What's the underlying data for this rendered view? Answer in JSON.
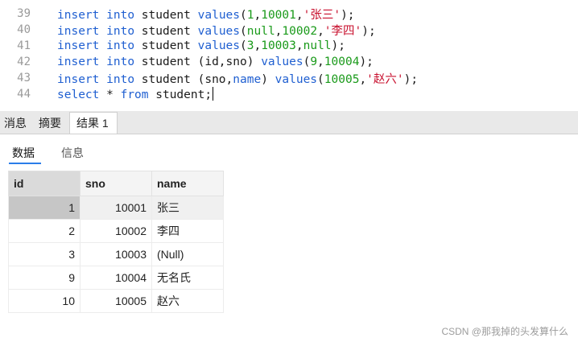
{
  "editor": {
    "lines": [
      {
        "num": "39",
        "code": [
          {
            "t": "insert",
            "c": "kw"
          },
          {
            "t": " "
          },
          {
            "t": "into",
            "c": "kw"
          },
          {
            "t": " student "
          },
          {
            "t": "values",
            "c": "kw"
          },
          {
            "t": "("
          },
          {
            "t": "1",
            "c": "num"
          },
          {
            "t": ","
          },
          {
            "t": "10001",
            "c": "num"
          },
          {
            "t": ","
          },
          {
            "t": "'张三'",
            "c": "str"
          },
          {
            "t": ");"
          }
        ]
      },
      {
        "num": "40",
        "code": [
          {
            "t": "insert",
            "c": "kw"
          },
          {
            "t": " "
          },
          {
            "t": "into",
            "c": "kw"
          },
          {
            "t": " student "
          },
          {
            "t": "values",
            "c": "kw"
          },
          {
            "t": "("
          },
          {
            "t": "null",
            "c": "num"
          },
          {
            "t": ","
          },
          {
            "t": "10002",
            "c": "num"
          },
          {
            "t": ","
          },
          {
            "t": "'李四'",
            "c": "str"
          },
          {
            "t": ");"
          }
        ]
      },
      {
        "num": "41",
        "code": [
          {
            "t": "insert",
            "c": "kw"
          },
          {
            "t": " "
          },
          {
            "t": "into",
            "c": "kw"
          },
          {
            "t": " student "
          },
          {
            "t": "values",
            "c": "kw"
          },
          {
            "t": "("
          },
          {
            "t": "3",
            "c": "num"
          },
          {
            "t": ","
          },
          {
            "t": "10003",
            "c": "num"
          },
          {
            "t": ","
          },
          {
            "t": "null",
            "c": "num"
          },
          {
            "t": ");"
          }
        ]
      },
      {
        "num": "42",
        "code": [
          {
            "t": "insert",
            "c": "kw"
          },
          {
            "t": " "
          },
          {
            "t": "into",
            "c": "kw"
          },
          {
            "t": " student (id,sno) "
          },
          {
            "t": "values",
            "c": "kw"
          },
          {
            "t": "("
          },
          {
            "t": "9",
            "c": "num"
          },
          {
            "t": ","
          },
          {
            "t": "10004",
            "c": "num"
          },
          {
            "t": ");"
          }
        ]
      },
      {
        "num": "43",
        "code": [
          {
            "t": "insert",
            "c": "kw"
          },
          {
            "t": " "
          },
          {
            "t": "into",
            "c": "kw"
          },
          {
            "t": " student (sno,"
          },
          {
            "t": "name",
            "c": "kw"
          },
          {
            "t": ") "
          },
          {
            "t": "values",
            "c": "kw"
          },
          {
            "t": "("
          },
          {
            "t": "10005",
            "c": "num"
          },
          {
            "t": ","
          },
          {
            "t": "'赵六'",
            "c": "str"
          },
          {
            "t": ");"
          }
        ]
      },
      {
        "num": "44",
        "caret": true,
        "code": [
          {
            "t": "select",
            "c": "kw"
          },
          {
            "t": " * "
          },
          {
            "t": "from",
            "c": "kw"
          },
          {
            "t": " student;"
          }
        ]
      }
    ]
  },
  "tabs": {
    "messages": "消息",
    "summary": "摘要",
    "result1": "结果 1"
  },
  "subtabs": {
    "data": "数据",
    "info": "信息"
  },
  "grid": {
    "columns": [
      "id",
      "sno",
      "name"
    ],
    "rows": [
      {
        "id": "1",
        "sno": "10001",
        "name": "张三",
        "is_null": false
      },
      {
        "id": "2",
        "sno": "10002",
        "name": "李四",
        "is_null": false
      },
      {
        "id": "3",
        "sno": "10003",
        "name": "(Null)",
        "is_null": true
      },
      {
        "id": "9",
        "sno": "10004",
        "name": "无名氏",
        "is_null": false
      },
      {
        "id": "10",
        "sno": "10005",
        "name": "赵六",
        "is_null": false
      }
    ],
    "selected_row": 0
  },
  "watermark": "CSDN @那我掉的头发算什么",
  "colors": {
    "keyword": "#1f5fd1",
    "number": "#1a9a1a",
    "string": "#c8102e",
    "active_underline": "#2b7de9"
  }
}
